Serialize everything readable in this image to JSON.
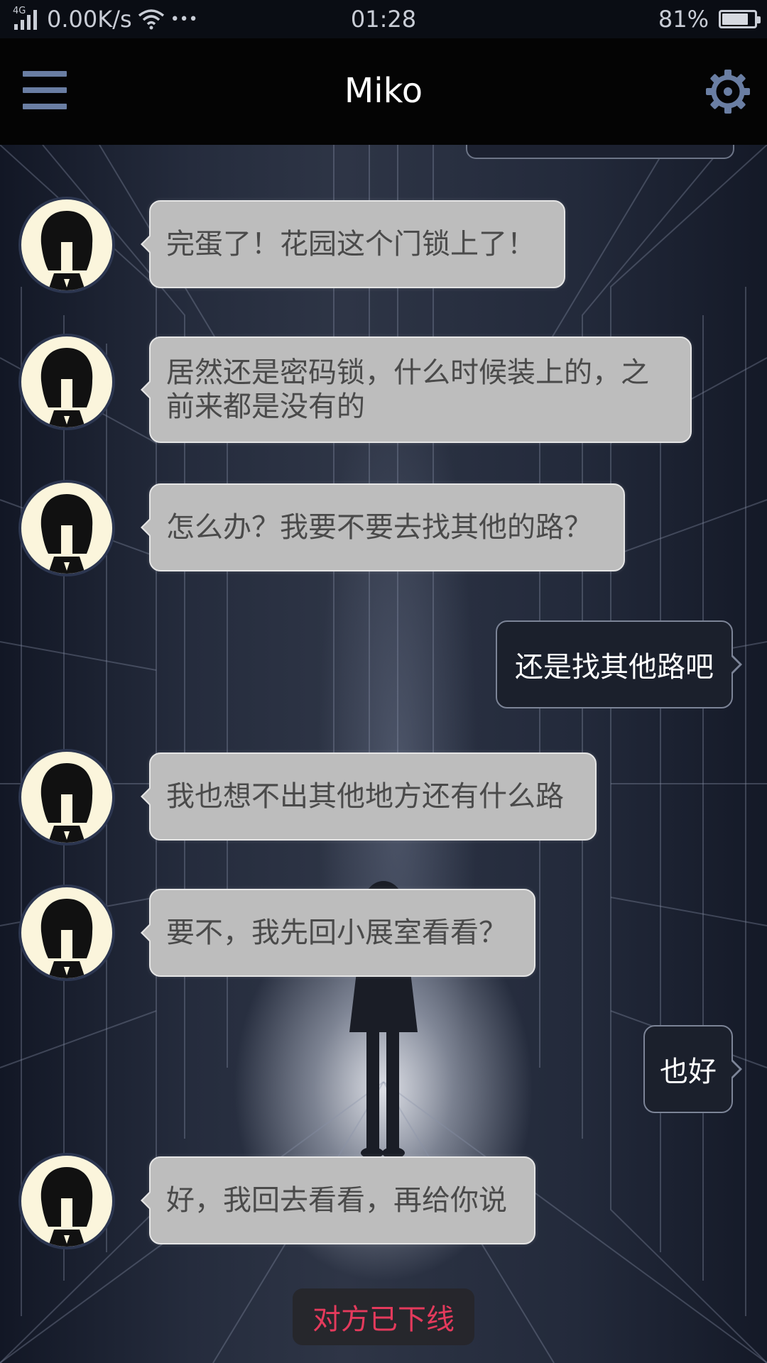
{
  "status_bar": {
    "network_type": "4G",
    "speed": "0.00K/s",
    "more": "•••",
    "time": "01:28",
    "battery_percent": "81%",
    "battery_level": 0.81,
    "icons": [
      "signal-icon",
      "wifi-icon",
      "battery-icon"
    ]
  },
  "header": {
    "title": "Miko",
    "menu_icon": "hamburger-menu-icon",
    "settings_icon": "gear-icon",
    "accent_color": "#6a7ea3"
  },
  "messages": [
    {
      "from": "miko",
      "text": "完蛋了！花园这个门锁上了！"
    },
    {
      "from": "miko",
      "text": "居然还是密码锁，什么时候装上的，之前来都是没有的"
    },
    {
      "from": "miko",
      "text": "怎么办？我要不要去找其他的路？"
    },
    {
      "from": "me",
      "text": "还是找其他路吧"
    },
    {
      "from": "miko",
      "text": "我也想不出其他地方还有什么路"
    },
    {
      "from": "miko",
      "text": "要不，我先回小展室看看？"
    },
    {
      "from": "me",
      "text": "也好"
    },
    {
      "from": "miko",
      "text": "好，我回去看看，再给你说"
    }
  ],
  "footer": {
    "status_text": "对方已下线",
    "status_color": "#e43a5c"
  }
}
